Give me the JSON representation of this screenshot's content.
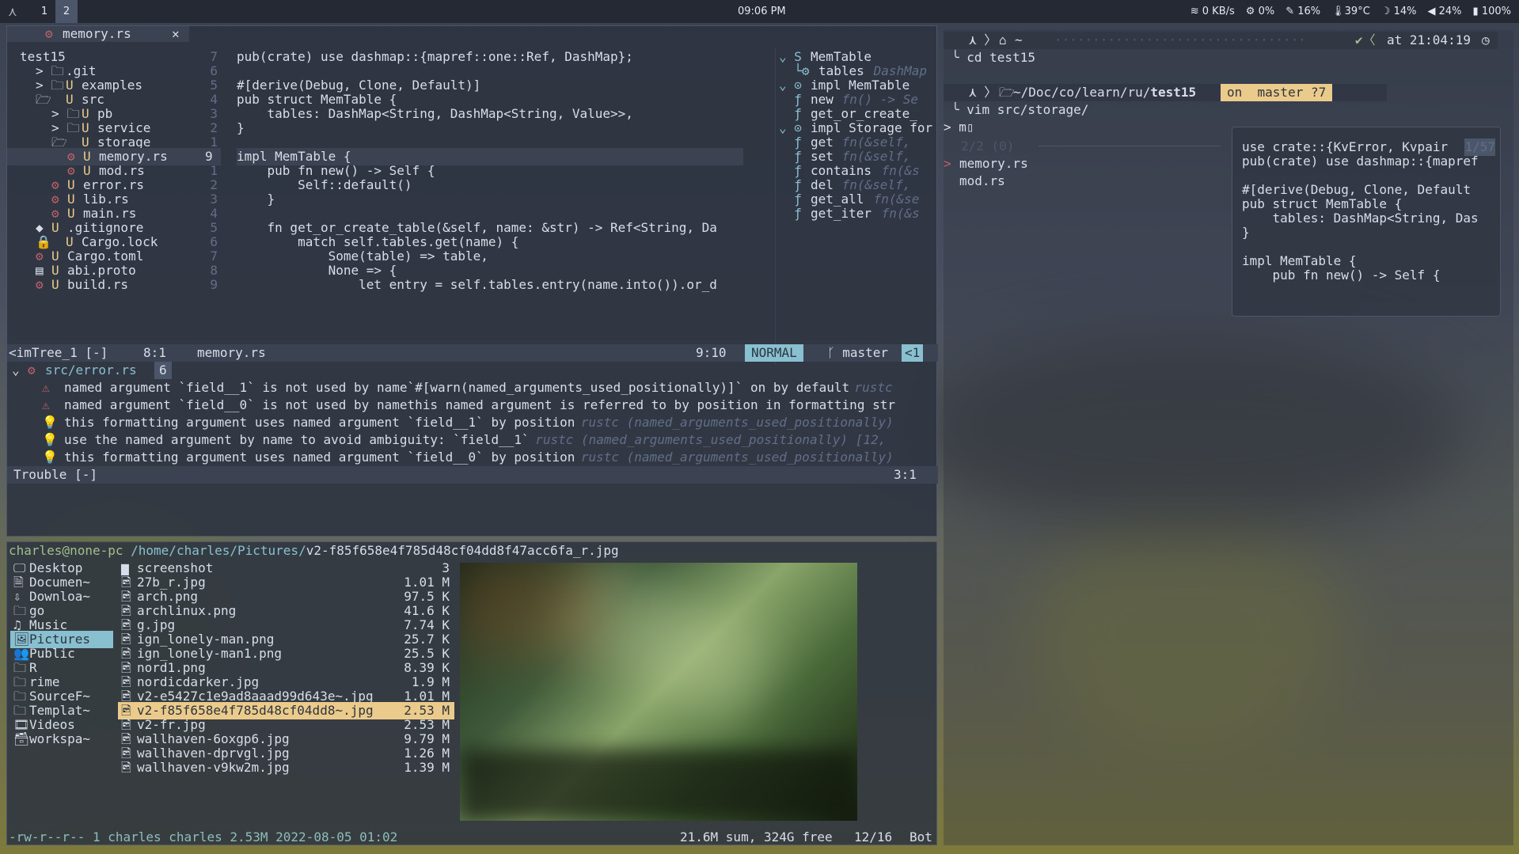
{
  "topbar": {
    "logo": "⋏",
    "workspaces": [
      "1",
      "2"
    ],
    "clock": "09:06 PM",
    "net": "0 KB/s",
    "cpu": "0%",
    "mem": "16%",
    "temp": "39°C",
    "bright": "14%",
    "vol": "24%",
    "battery": "100%"
  },
  "nvim": {
    "tab": "memory.rs",
    "tab_close": "✕",
    "tree": [
      {
        "t": "test15",
        "ind": 0,
        "icon": "",
        "b": ""
      },
      {
        "t": ".git",
        "ind": 1,
        "icon": "> 🗀",
        "b": ""
      },
      {
        "t": "examples",
        "ind": 1,
        "icon": "> 🗀",
        "b": "U"
      },
      {
        "t": "src",
        "ind": 1,
        "icon": "🗁",
        "b": "U"
      },
      {
        "t": "pb",
        "ind": 2,
        "icon": "> 🗀",
        "b": "U"
      },
      {
        "t": "service",
        "ind": 2,
        "icon": "> 🗀",
        "b": "U"
      },
      {
        "t": "storage",
        "ind": 2,
        "icon": "🗁",
        "b": "U"
      },
      {
        "t": "memory.rs",
        "ind": 3,
        "icon": "⚙",
        "b": "U",
        "n": "9"
      },
      {
        "t": "mod.rs",
        "ind": 3,
        "icon": "⚙",
        "b": "U"
      },
      {
        "t": "error.rs",
        "ind": 2,
        "icon": "⚙",
        "b": "U"
      },
      {
        "t": "lib.rs",
        "ind": 2,
        "icon": "⚙",
        "b": "U"
      },
      {
        "t": "main.rs",
        "ind": 2,
        "icon": "⚙",
        "b": "U"
      },
      {
        "t": ".gitignore",
        "ind": 1,
        "icon": "◆",
        "b": "U"
      },
      {
        "t": "Cargo.lock",
        "ind": 1,
        "icon": "🔒",
        "b": "U"
      },
      {
        "t": "Cargo.toml",
        "ind": 1,
        "icon": "⚙",
        "b": "U"
      },
      {
        "t": "abi.proto",
        "ind": 1,
        "icon": "▤",
        "b": "U"
      },
      {
        "t": "build.rs",
        "ind": 1,
        "icon": "⚙",
        "b": "U"
      }
    ],
    "gutter": [
      "7",
      "6",
      "5",
      "4",
      "3",
      "2",
      "1",
      "9",
      "1",
      "2",
      "3",
      "4",
      "5",
      "6",
      "7",
      "8",
      "9"
    ],
    "code": [
      "pub(crate) use dashmap::{mapref::one::Ref, DashMap};",
      "",
      "#[derive(Debug, Clone, Default)]",
      "pub struct MemTable {",
      "    tables: DashMap<String, DashMap<String, Value>>,",
      "}",
      "",
      "impl MemTable {",
      "    pub fn new() -> Self {",
      "        Self::default()",
      "    }",
      "",
      "    fn get_or_create_table(&self, name: &str) -> Ref<String, Da",
      "        match self.tables.get(name) {",
      "            Some(table) => table,",
      "            None => {",
      "                let entry = self.tables.entry(name.into()).or_d"
    ],
    "outline": [
      {
        "p": "⌄ S",
        "t": "MemTable",
        "h": ""
      },
      {
        "p": "  └⚙",
        "t": "tables",
        "h": " DashMap"
      },
      {
        "p": "⌄ ⊙",
        "t": "impl MemTable",
        "h": ""
      },
      {
        "p": "  ƒ",
        "t": "new",
        "h": " fn() -> Se"
      },
      {
        "p": "  ƒ",
        "t": "get_or_create_",
        "h": ""
      },
      {
        "p": "⌄ ⊙",
        "t": "impl Storage for",
        "h": ""
      },
      {
        "p": "  ƒ",
        "t": "get",
        "h": " fn(&self,"
      },
      {
        "p": "  ƒ",
        "t": "set",
        "h": " fn(&self,"
      },
      {
        "p": "  ƒ",
        "t": "contains",
        "h": " fn(&s"
      },
      {
        "p": "  ƒ",
        "t": "del",
        "h": " fn(&self,"
      },
      {
        "p": "  ƒ",
        "t": "get_all",
        "h": " fn(&se"
      },
      {
        "p": "  ƒ",
        "t": "get_iter",
        "h": " fn(&s"
      }
    ],
    "status": {
      "left": "<imTree_1 [-]",
      "pos": "8:1",
      "file": "memory.rs",
      "cursor": "9:10",
      "mode": "NORMAL",
      "branch": "master",
      "extra": "<1"
    },
    "trouble": {
      "file": "src/error.rs",
      "count": "6",
      "items": [
        {
          "i": "⚠",
          "t": "named argument `field__1` is not used by name`#[warn(named_arguments_used_positionally)]` on by default",
          "s": " rustc"
        },
        {
          "i": "⚠",
          "t": "named argument `field__0` is not used by namethis named argument is referred to by position in formatting str",
          "s": ""
        },
        {
          "i": "💡",
          "t": "this formatting argument uses named argument `field__1` by position",
          "s": " rustc (named_arguments_used_positionally)"
        },
        {
          "i": "💡",
          "t": "use the named argument by name to avoid ambiguity: `field__1`",
          "s": " rustc (named_arguments_used_positionally) [12,"
        },
        {
          "i": "💡",
          "t": "this formatting argument uses named argument `field__0` by position",
          "s": " rustc (named_arguments_used_positionally)"
        }
      ],
      "status": "Trouble [-]",
      "pos": "3:1"
    }
  },
  "term": {
    "p1_path": "~",
    "p1_time": "at 21:04:19",
    "cmd1": "cd test15",
    "p2_path": "~/Doc/co/learn/ru/",
    "p2_dir": "test15",
    "p2_git": "on  master ?7",
    "cmd2": "vim src/storage/",
    "input": "m",
    "fzf_count": "2/2 (0)",
    "fzf_items": [
      "memory.rs",
      "mod.rs"
    ],
    "preview": [
      "use crate::{KvError, Kvpair",
      "pub(crate) use dashmap::{mapref",
      "",
      "#[derive(Debug, Clone, Default",
      "pub struct MemTable {",
      "    tables: DashMap<String, Das",
      "}",
      "",
      "impl MemTable {",
      "    pub fn new() -> Self {"
    ],
    "preview_count": "1/57"
  },
  "ranger": {
    "header_user": "charles@none-pc",
    "header_path": "/home/charles/Pictures/",
    "header_file": "v2-f85f658e4f785d48cf04dd8f47acc6fa_r.jpg",
    "places": [
      {
        "i": "🖵",
        "t": "Desktop"
      },
      {
        "i": "🗎",
        "t": "Documen~"
      },
      {
        "i": "⇩",
        "t": "Downloa~"
      },
      {
        "i": "🗀",
        "t": "go"
      },
      {
        "i": "♫",
        "t": "Music"
      },
      {
        "i": "🖼",
        "t": "Pictures",
        "sel": true
      },
      {
        "i": "👥",
        "t": "Public"
      },
      {
        "i": "🗀",
        "t": "R"
      },
      {
        "i": "🗀",
        "t": "rime"
      },
      {
        "i": "🗀",
        "t": "SourceF~"
      },
      {
        "i": "🗀",
        "t": "Templat~"
      },
      {
        "i": "🎞",
        "t": "Videos"
      },
      {
        "i": "🗃",
        "t": "workspa~"
      }
    ],
    "files": [
      {
        "n": "screenshot",
        "s": "3",
        "dir": true
      },
      {
        "n": "27b_r.jpg",
        "s": "1.01 M"
      },
      {
        "n": "arch.png",
        "s": "97.5 K"
      },
      {
        "n": "archlinux.png",
        "s": "41.6 K"
      },
      {
        "n": "g.jpg",
        "s": "7.74 K"
      },
      {
        "n": "ign_lonely-man.png",
        "s": "25.7 K"
      },
      {
        "n": "ign_lonely-man1.png",
        "s": "25.5 K"
      },
      {
        "n": "nord1.png",
        "s": "8.39 K"
      },
      {
        "n": "nordicdarker.jpg",
        "s": "1.9 M"
      },
      {
        "n": "v2-e5427c1e9ad8aaad99d643e~.jpg",
        "s": "1.01 M"
      },
      {
        "n": "v2-f85f658e4f785d48cf04dd8~.jpg",
        "s": "2.53 M",
        "sel": true
      },
      {
        "n": "v2-fr.jpg",
        "s": "2.53 M"
      },
      {
        "n": "wallhaven-6oxgp6.jpg",
        "s": "9.79 M"
      },
      {
        "n": "wallhaven-dprvgl.jpg",
        "s": "1.26 M"
      },
      {
        "n": "wallhaven-v9kw2m.jpg",
        "s": "1.39 M"
      }
    ],
    "footer_left": "-rw-r--r-- 1 charles charles 2.53M 2022-08-05 01:02",
    "footer_sum": "21.6M sum, 324G free",
    "footer_pos": "12/16",
    "footer_scroll": "Bot"
  }
}
